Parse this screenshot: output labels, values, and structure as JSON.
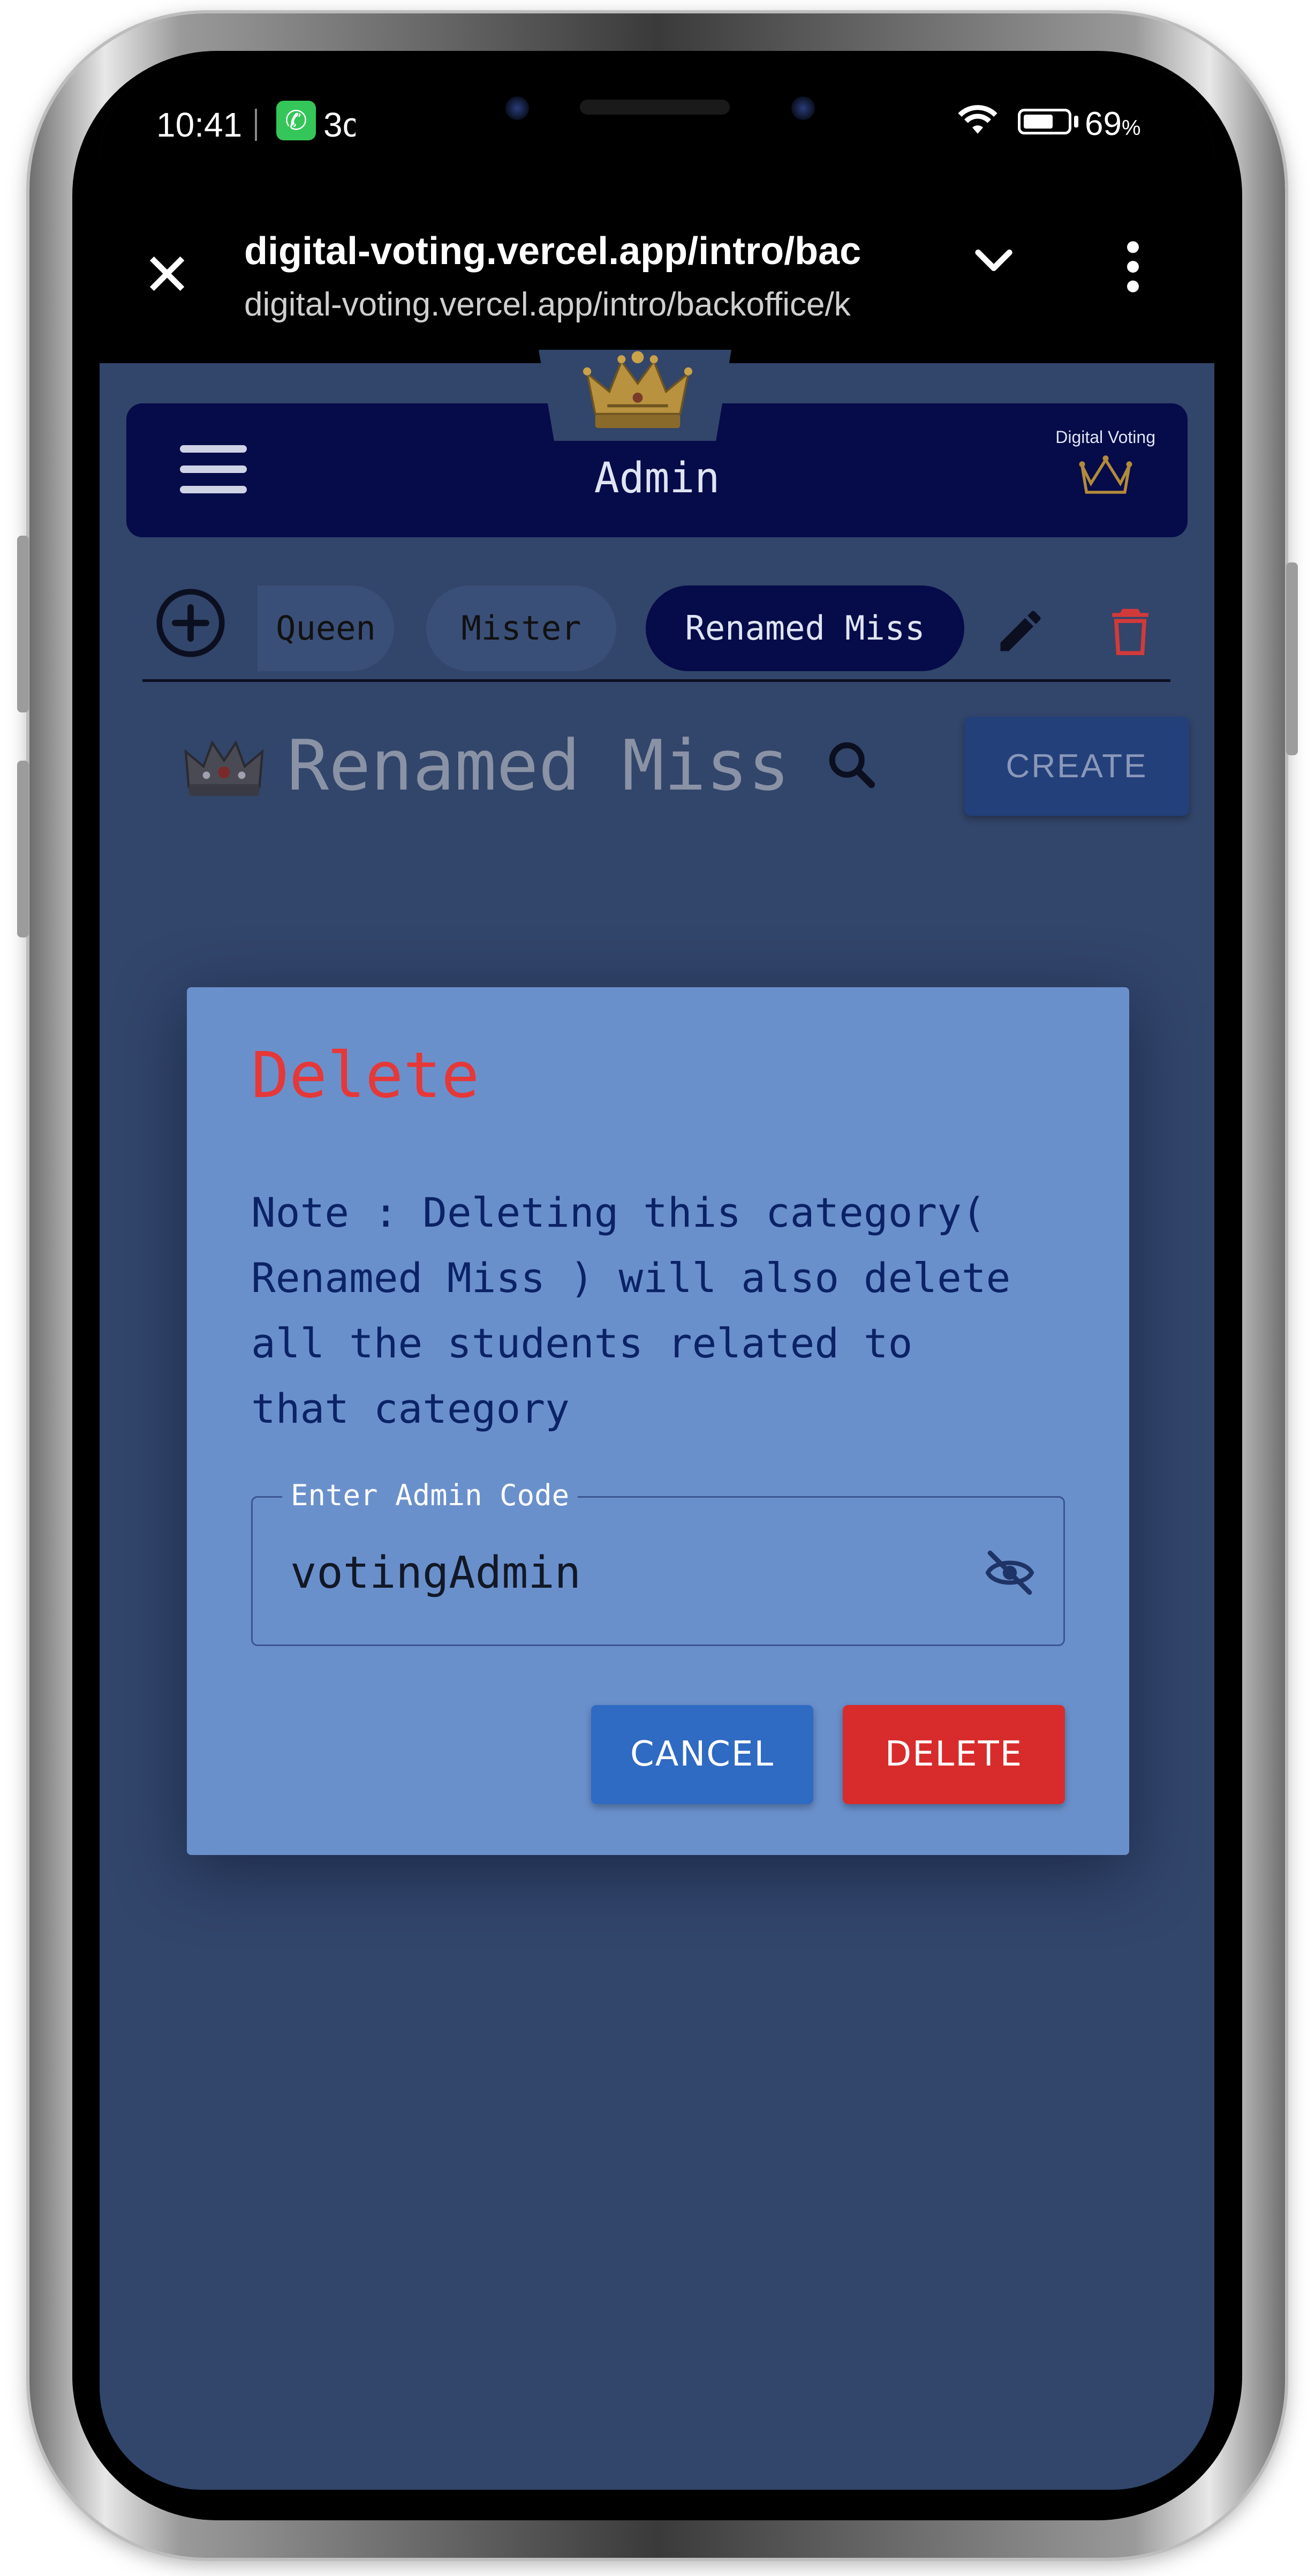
{
  "status_bar": {
    "time": "10:41",
    "call_indicator_text": "3c",
    "battery_percent": "69",
    "battery_unit": "%",
    "battery_level": 0.69
  },
  "browser": {
    "page_title": "digital-voting.vercel.app/intro/bac",
    "url": "digital-voting.vercel.app/intro/backoffice/k"
  },
  "header": {
    "title": "Admin",
    "brand": "Digital Voting"
  },
  "tabs": [
    {
      "label": "Queen",
      "active": false
    },
    {
      "label": "Mister",
      "active": false
    },
    {
      "label": "Renamed Miss",
      "active": true
    }
  ],
  "section": {
    "title": "Renamed Miss",
    "create_label": "CREATE"
  },
  "dialog": {
    "title": "Delete",
    "message": "Note : Deleting this category(\nRenamed Miss ) will also delete\nall the students related to\nthat category",
    "field_label": "Enter Admin Code",
    "field_value": "votingAdmin",
    "cancel_label": "CANCEL",
    "delete_label": "DELETE"
  },
  "colors": {
    "page_bg": "#32456a",
    "header_bg": "#060b4a",
    "dialog_bg": "#6a90cc",
    "danger": "#d82c2c",
    "primary": "#2f6ac3"
  }
}
